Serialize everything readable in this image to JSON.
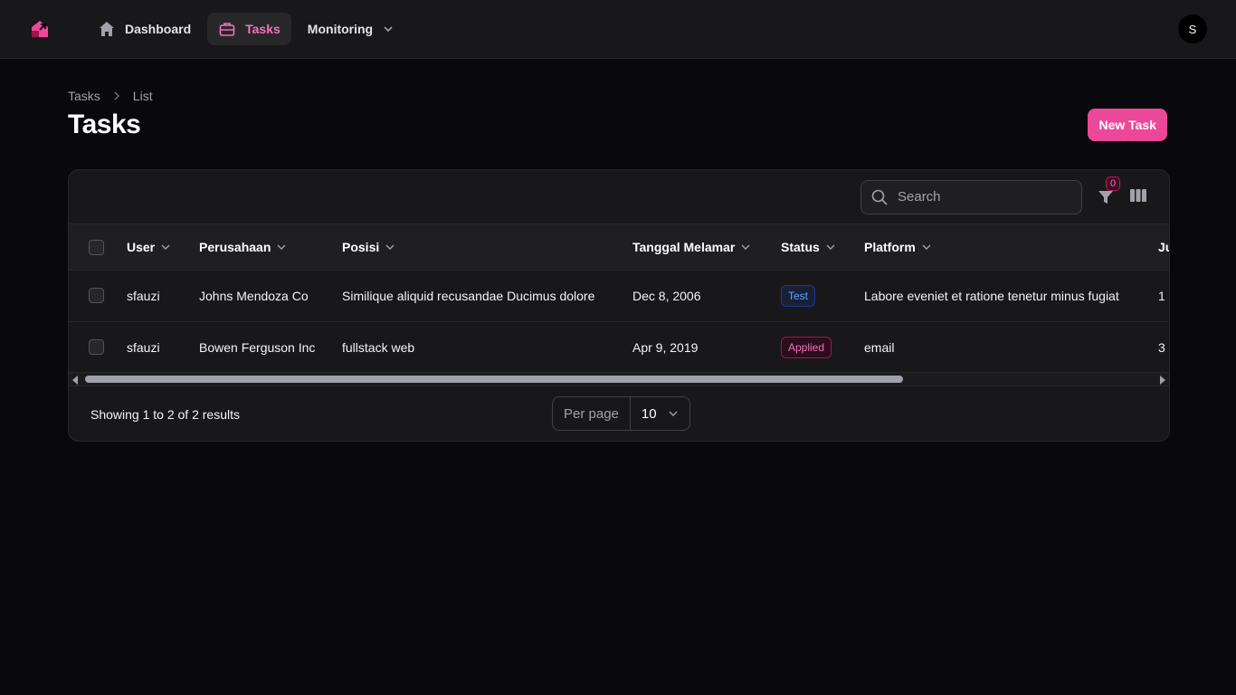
{
  "nav": {
    "items": [
      {
        "label": "Dashboard",
        "icon": "home-icon"
      },
      {
        "label": "Tasks",
        "icon": "briefcase-icon",
        "active": true
      },
      {
        "label": "Monitoring",
        "icon": "chevron-down-icon"
      }
    ],
    "avatar_initial": "S"
  },
  "breadcrumb": [
    "Tasks",
    "List"
  ],
  "page_title": "Tasks",
  "new_button_label": "New Task",
  "search": {
    "placeholder": "Search"
  },
  "filter_count": "0",
  "table": {
    "columns": [
      "User",
      "Perusahaan",
      "Posisi",
      "Tanggal Melamar",
      "Status",
      "Platform",
      "Ju"
    ],
    "rows": [
      {
        "user": "sfauzi",
        "perusahaan": "Johns Mendoza Co",
        "posisi": "Similique aliquid recusandae Ducimus dolore",
        "tanggal": "Dec 8, 2006",
        "status": "Test",
        "platform": "Labore eveniet et ratione tenetur minus fugiat",
        "ju": "1"
      },
      {
        "user": "sfauzi",
        "perusahaan": "Bowen Ferguson Inc",
        "posisi": "fullstack web",
        "tanggal": "Apr 9, 2019",
        "status": "Applied",
        "platform": "email",
        "ju": "3"
      }
    ]
  },
  "footer": {
    "summary": "Showing 1 to 2 of 2 results",
    "per_page_label": "Per page",
    "per_page_value": "10"
  },
  "colors": {
    "accent": "#ec4899",
    "background": "#09090b",
    "surface": "#18181b"
  }
}
